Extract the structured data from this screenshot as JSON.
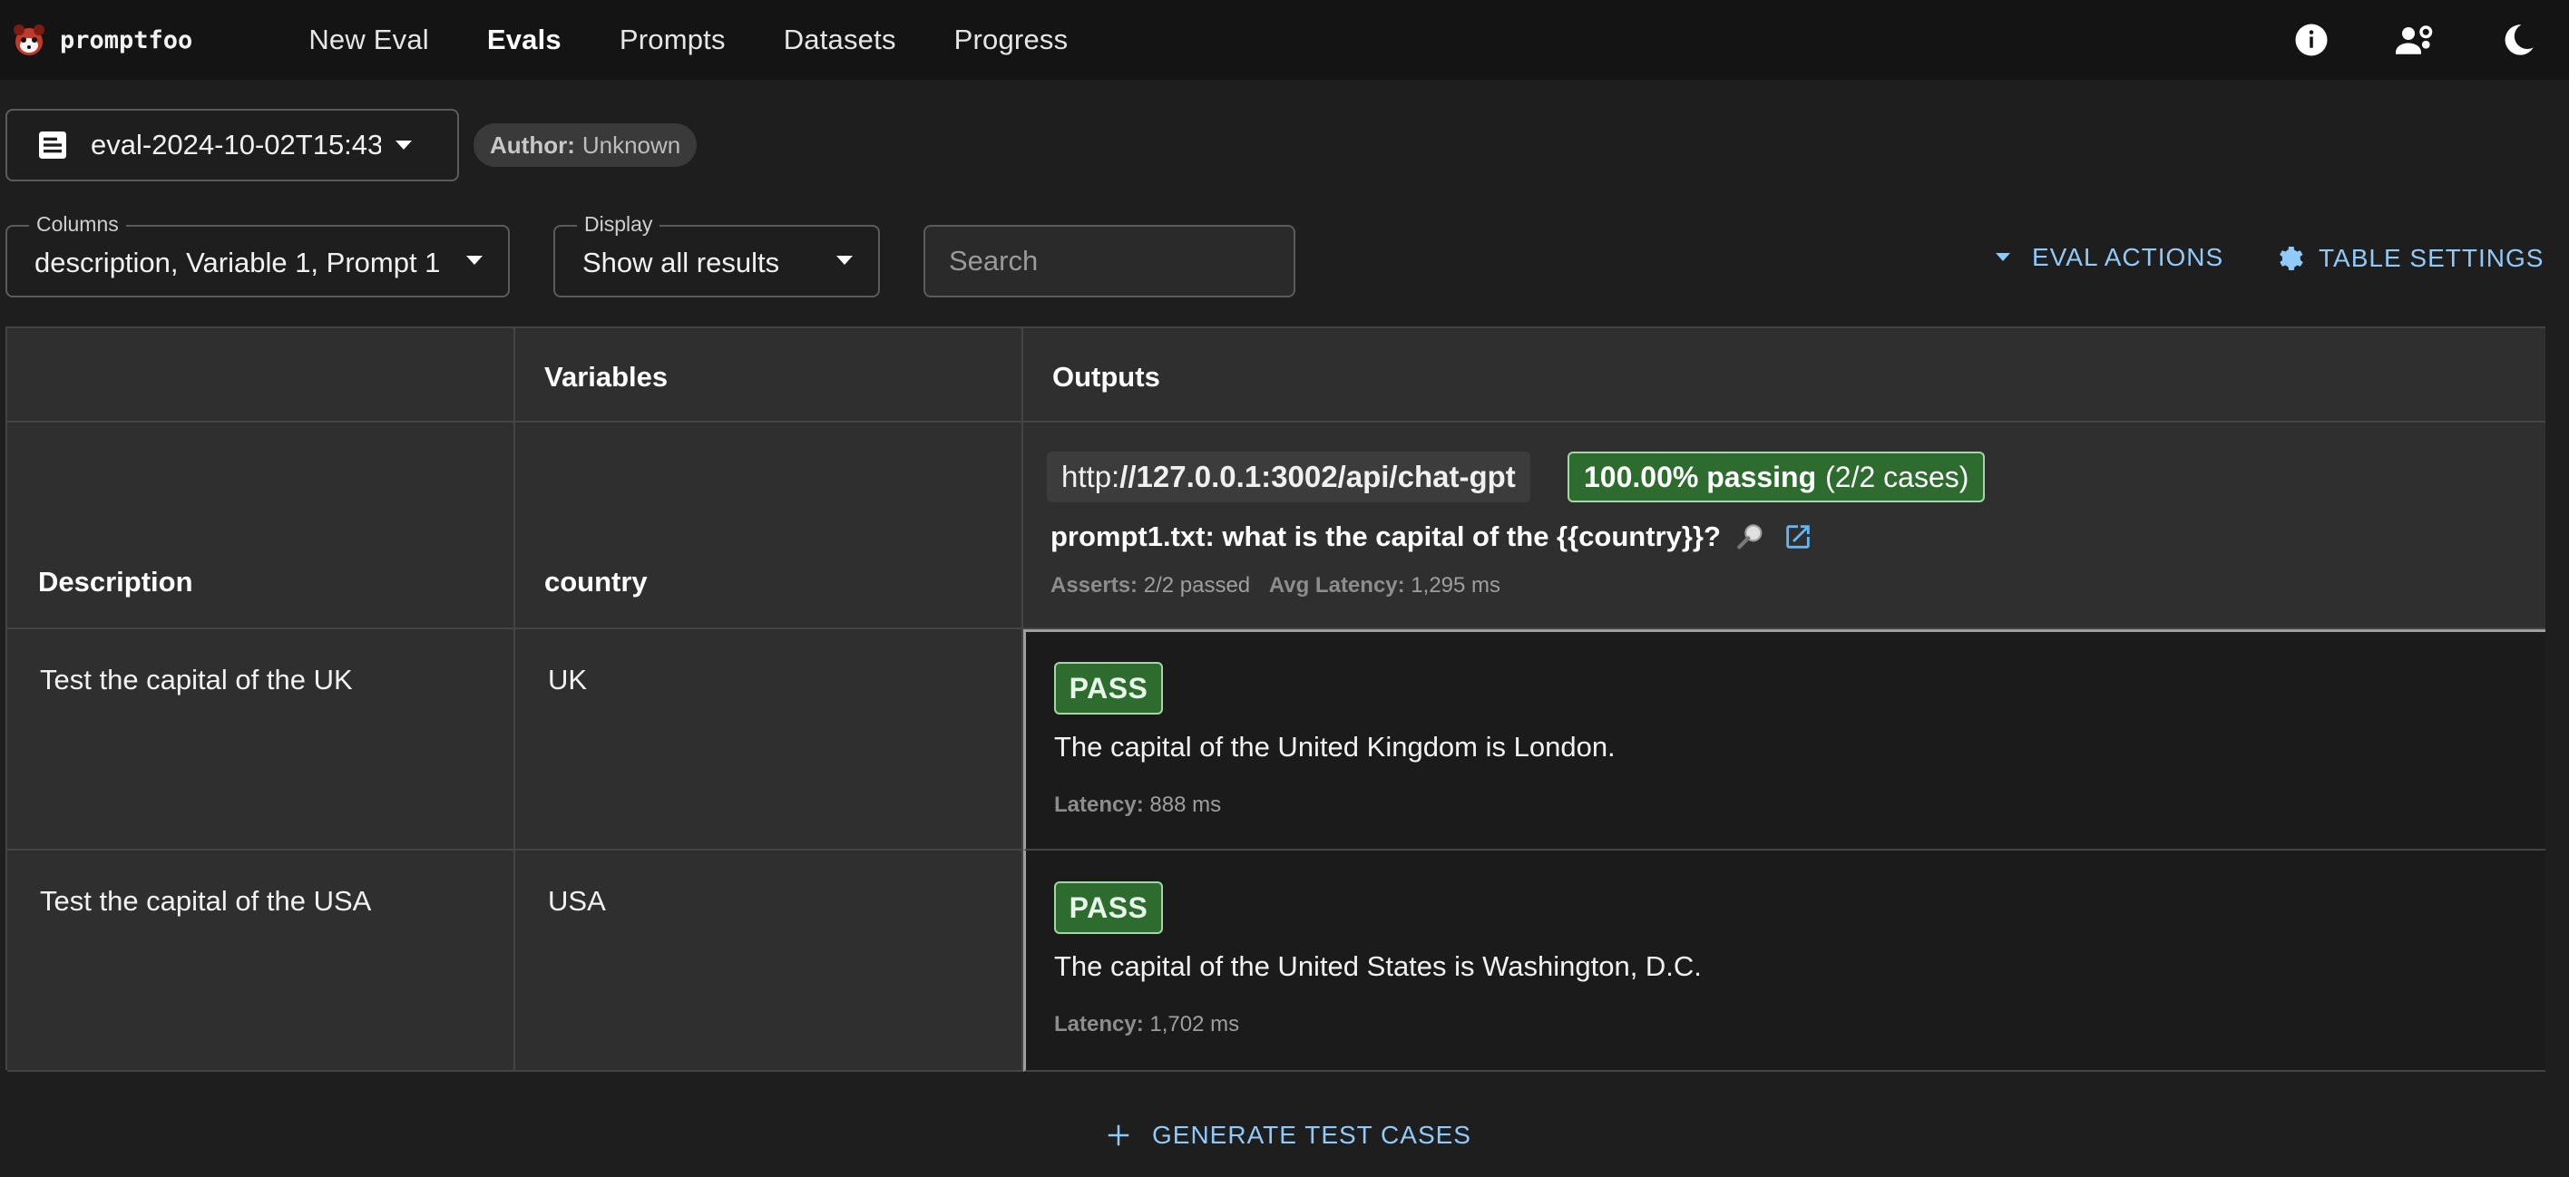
{
  "app": {
    "name": "promptfoo"
  },
  "nav": [
    {
      "label": "New Eval",
      "active": false
    },
    {
      "label": "Evals",
      "active": true
    },
    {
      "label": "Prompts",
      "active": false
    },
    {
      "label": "Datasets",
      "active": false
    },
    {
      "label": "Progress",
      "active": false
    }
  ],
  "top_icons": [
    "info-icon",
    "user-settings-icon",
    "dark-mode-icon"
  ],
  "eval": {
    "selected": "eval-2024-10-02T15:43",
    "author_label": "Author:",
    "author_value": "Unknown"
  },
  "filters": {
    "columns_label": "Columns",
    "columns_value": "description, Variable 1, Prompt 1",
    "display_label": "Display",
    "display_value": "Show all results",
    "search_placeholder": "Search"
  },
  "actions": {
    "eval_actions": "EVAL ACTIONS",
    "table_settings": "TABLE SETTINGS"
  },
  "table": {
    "group_headers": {
      "variables": "Variables",
      "outputs": "Outputs"
    },
    "headers": {
      "description": "Description",
      "var1": "country"
    },
    "prompt": {
      "provider_prefix": "http:",
      "provider_rest": "//127.0.0.1:3002/api/chat-gpt",
      "pass_pct": "100.00% passing",
      "pass_cases": "(2/2 cases)",
      "text": "prompt1.txt: what is the capital of the {{country}}?",
      "asserts_label": "Asserts:",
      "asserts_value": "2/2 passed",
      "latency_label": "Avg Latency:",
      "latency_value": "1,295 ms"
    },
    "rows": [
      {
        "description": "Test the capital of the UK",
        "country": "UK",
        "status": "PASS",
        "output": "The capital of the United Kingdom is London.",
        "latency_label": "Latency:",
        "latency_value": "888 ms"
      },
      {
        "description": "Test the capital of the USA",
        "country": "USA",
        "status": "PASS",
        "output": "The capital of the United States is Washington, D.C.",
        "latency_label": "Latency:",
        "latency_value": "1,702 ms"
      }
    ]
  },
  "generate": {
    "label": "GENERATE TEST CASES"
  },
  "colors": {
    "accent": "#90caf9",
    "pass_bg": "#2e6b2e",
    "pass_border": "#a5d6a7",
    "background": "#1e1e1e"
  }
}
